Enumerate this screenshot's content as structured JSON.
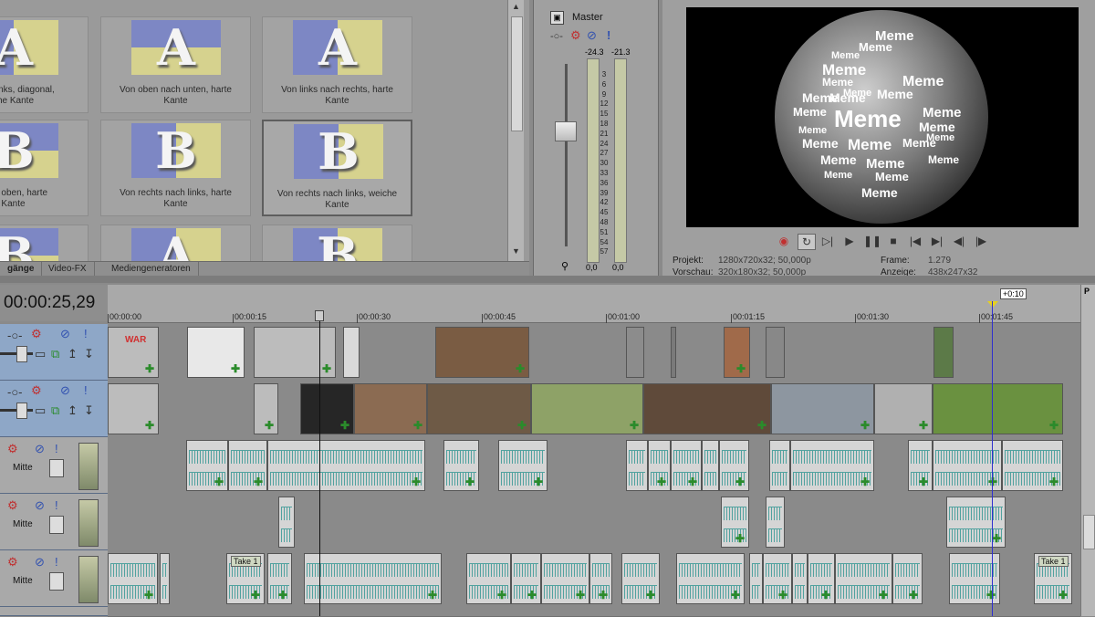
{
  "transitions": {
    "items": [
      {
        "caption": "nach links, diagonal,\nche Kante",
        "letter": "A",
        "layout": "split-v"
      },
      {
        "caption": "Von oben nach unten, harte\nKante",
        "letter": "A",
        "layout": "split-h"
      },
      {
        "caption": "Von links nach rechts, harte\nKante",
        "letter": "A",
        "layout": "split-v"
      },
      {
        "caption": "nach oben, harte\nKante",
        "letter": "B",
        "layout": "split-h"
      },
      {
        "caption": "Von rechts nach links, harte\nKante",
        "letter": "B",
        "layout": "split-v"
      },
      {
        "caption": "Von rechts nach links, weiche\nKante",
        "letter": "B",
        "layout": "split-v",
        "selected": true
      },
      {
        "caption": "",
        "letter": "B",
        "layout": "split-h"
      },
      {
        "caption": "",
        "letter": "A",
        "layout": "split-v"
      },
      {
        "caption": "",
        "letter": "B",
        "layout": "split-v"
      }
    ]
  },
  "tabs": [
    "gänge",
    "Video-FX",
    "Mediengeneratoren"
  ],
  "mixer": {
    "title": "Master",
    "peak_left": "-24.3",
    "peak_right": "-21.3",
    "scale": [
      "3",
      "6",
      "9",
      "12",
      "15",
      "18",
      "21",
      "24",
      "27",
      "30",
      "33",
      "36",
      "39",
      "42",
      "45",
      "48",
      "51",
      "54",
      "57"
    ],
    "bottom_left": "0,0",
    "bottom_right": "0,0"
  },
  "preview": {
    "words": [
      "Meme",
      "Meme",
      "Meme",
      "Meme",
      "Meme",
      "Meme",
      "Meme",
      "Meme",
      "Meme",
      "Meme",
      "Meme",
      "Meme",
      "Meme",
      "Meme",
      "Meme",
      "Meme",
      "Meme",
      "Meme",
      "Meme",
      "Meme",
      "Meme",
      "Meme",
      "Meme",
      "Meme",
      "Meme"
    ],
    "projekt_label": "Projekt:",
    "projekt_value": "1280x720x32; 50,000p",
    "vorschau_label": "Vorschau:",
    "vorschau_value": "320x180x32; 50,000p",
    "frame_label": "Frame:",
    "frame_value": "1.279",
    "anzeige_label": "Anzeige:",
    "anzeige_value": "438x247x32"
  },
  "timeline": {
    "timecode": "00:00:25,29",
    "marker": "+0:10",
    "ruler": [
      "00:00:00",
      "00:00:15",
      "00:00:30",
      "00:00:45",
      "00:01:00",
      "00:01:15",
      "00:01:30",
      "00:01:45"
    ],
    "audio_pan_label": "Mitte",
    "take_label": "Take 1",
    "overlay_text": "WAR"
  },
  "colors": {
    "video_header": "#8ea7c7",
    "wave": "#3a9a96",
    "record": "#d03030"
  }
}
